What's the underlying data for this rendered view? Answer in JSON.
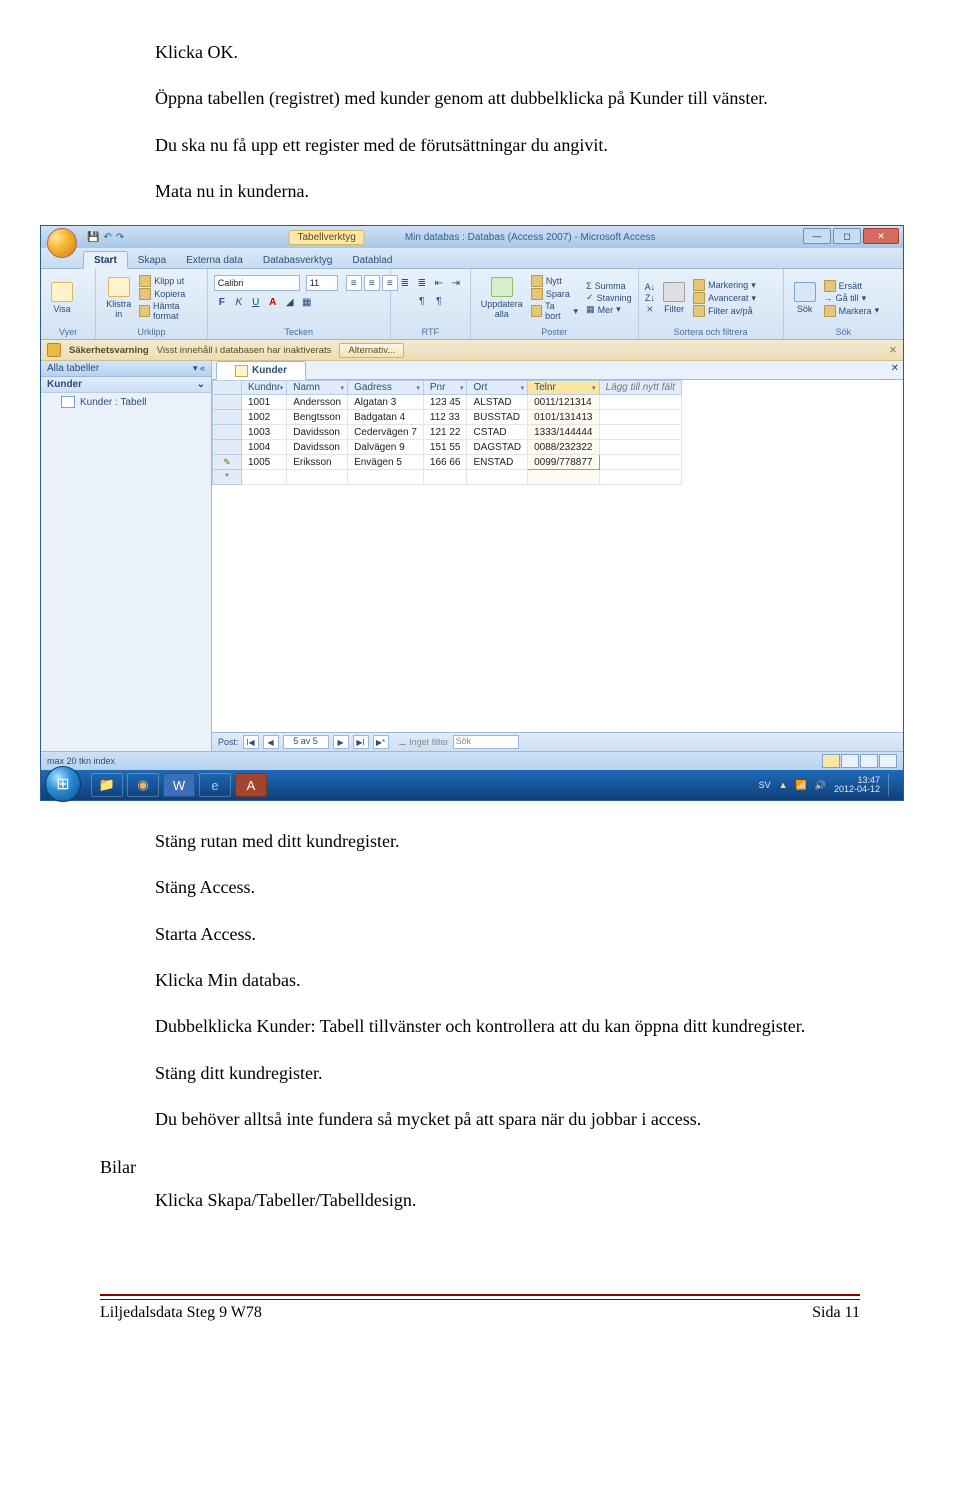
{
  "body_text": {
    "p1": "Klicka OK.",
    "p2": "Öppna tabellen (registret) med kunder genom att dubbelklicka på Kunder till vänster.",
    "p3": "Du ska nu få upp ett register med de förutsättningar du angivit.",
    "p4": "Mata nu in kunderna.",
    "p5": "Stäng rutan med ditt kundregister.",
    "p6": "Stäng Access.",
    "p7": "Starta Access.",
    "p8": "Klicka Min databas.",
    "p9": "Dubbelklicka Kunder: Tabell tillvänster och kontrollera att du kan öppna ditt kundregister.",
    "p10": "Stäng ditt kundregister.",
    "p11": "Du behöver alltså inte fundera så mycket på att spara när du jobbar i access.",
    "section": "Bilar",
    "p12": "Klicka Skapa/Tabeller/Tabelldesign."
  },
  "footer": {
    "left": "Liljedalsdata Steg 9 W78",
    "right": "Sida 11"
  },
  "screenshot": {
    "title_tool": "Tabellverktyg",
    "title_app": "Min databas : Databas (Access 2007) - Microsoft Access",
    "tabs": [
      "Start",
      "Skapa",
      "Externa data",
      "Databasverktyg",
      "Datablad"
    ],
    "ribbon": {
      "group_vyer": "Vyer",
      "visa": "Visa",
      "group_urklipp": "Urklipp",
      "klistra": "Klistra\nin",
      "klippu": "Klipp ut",
      "kopiera": "Kopiera",
      "hamta": "Hämta format",
      "group_tecken": "Tecken",
      "font": "Calibri",
      "size": "11",
      "group_rtf": "RTF",
      "group_poster": "Poster",
      "uppdatera": "Uppdatera\nalla",
      "nytt": "Nytt",
      "spara": "Spara",
      "tabort": "Ta bort",
      "summa": "Summa",
      "stavning": "Stavning",
      "mer": "Mer",
      "group_sort": "Sortera och filtrera",
      "filter": "Filter",
      "markering": "Markering",
      "avancerat": "Avancerat",
      "filterav": "Filter av/på",
      "group_sok": "Sök",
      "sok": "Sök",
      "ersatt": "Ersätt",
      "gatill": "Gå till",
      "markera": "Markera"
    },
    "security": {
      "label": "Säkerhetsvarning",
      "msg": "Visst innehåll i databasen har inaktiverats",
      "btn": "Alternativ..."
    },
    "nav": {
      "head": "Alla tabeller",
      "cat": "Kunder",
      "item": "Kunder : Tabell"
    },
    "doc_tab": "Kunder",
    "columns": [
      "Kundnr",
      "Namn",
      "Gadress",
      "Pnr",
      "Ort",
      "Telnr"
    ],
    "addfield": "Lägg till nytt fält",
    "rows": [
      {
        "Kundnr": "1001",
        "Namn": "Andersson",
        "Gadress": "Algatan 3",
        "Pnr": "123 45",
        "Ort": "ALSTAD",
        "Telnr": "0011/121314"
      },
      {
        "Kundnr": "1002",
        "Namn": "Bengtsson",
        "Gadress": "Badgatan 4",
        "Pnr": "112 33",
        "Ort": "BUSSTAD",
        "Telnr": "0101/131413"
      },
      {
        "Kundnr": "1003",
        "Namn": "Davidsson",
        "Gadress": "Cedervägen 7",
        "Pnr": "121 22",
        "Ort": "CSTAD",
        "Telnr": "1333/144444"
      },
      {
        "Kundnr": "1004",
        "Namn": "Davidsson",
        "Gadress": "Dalvägen 9",
        "Pnr": "151 55",
        "Ort": "DAGSTAD",
        "Telnr": "0088/232322"
      },
      {
        "Kundnr": "1005",
        "Namn": "Eriksson",
        "Gadress": "Envägen 5",
        "Pnr": "166 66",
        "Ort": "ENSTAD",
        "Telnr": "0099/778877"
      }
    ],
    "recnav": {
      "label": "Post:",
      "pos": "5 av 5",
      "nofilter": "Inget filter",
      "search": "Sök"
    },
    "status": "max 20 tkn index",
    "tray": {
      "lang": "SV",
      "time": "13:47",
      "date": "2012-04-12"
    }
  }
}
